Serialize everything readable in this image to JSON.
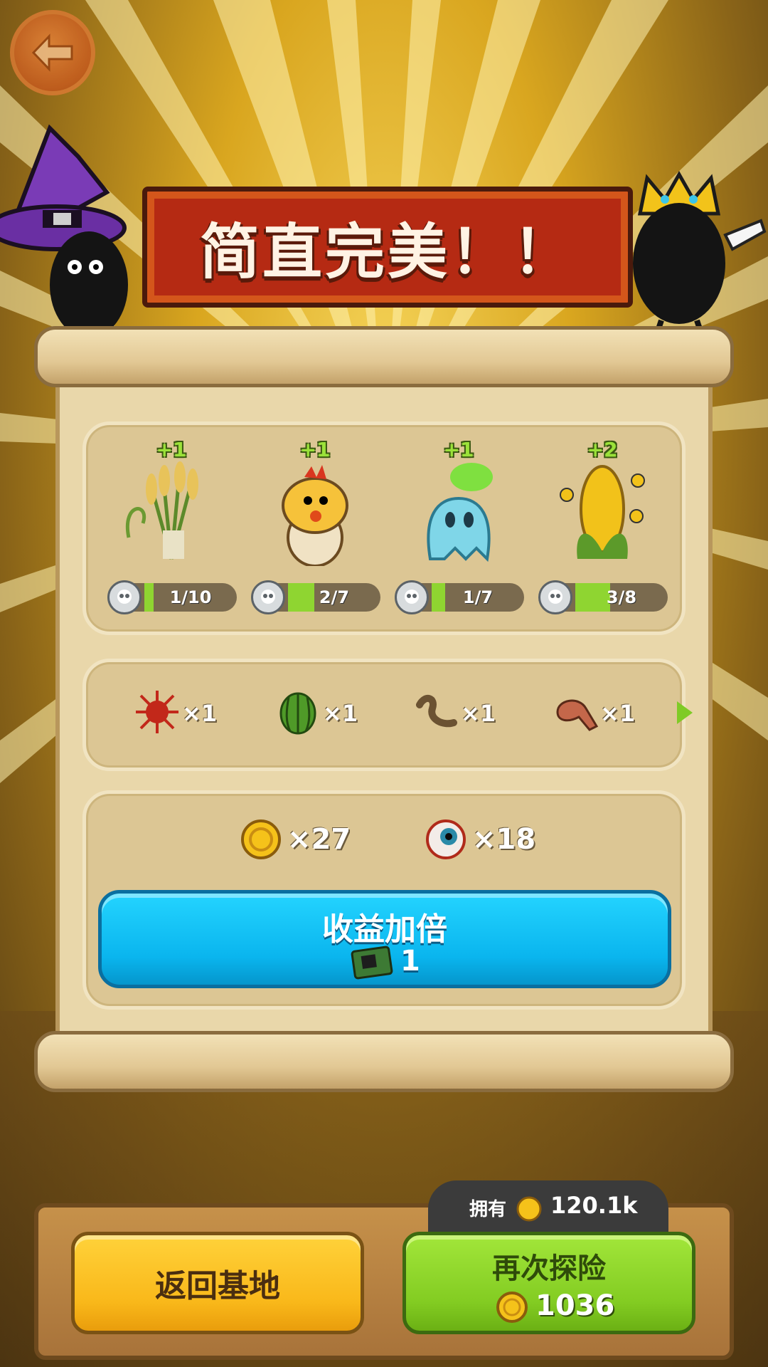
{
  "banner": {
    "title": "简直完美！！"
  },
  "creatures": [
    {
      "name": "rice",
      "plus": "+1",
      "progress_text": "1/10",
      "progress": 0.1
    },
    {
      "name": "chick",
      "plus": "+1",
      "progress_text": "2/7",
      "progress": 0.2857
    },
    {
      "name": "ghost-radish",
      "plus": "+1",
      "progress_text": "1/7",
      "progress": 0.1429
    },
    {
      "name": "corn",
      "plus": "+2",
      "progress_text": "3/8",
      "progress": 0.375
    }
  ],
  "items": [
    {
      "icon": "red-urchin-icon",
      "count": "×1"
    },
    {
      "icon": "watermelon-icon",
      "count": "×1"
    },
    {
      "icon": "worm-icon",
      "count": "×1"
    },
    {
      "icon": "drumstick-icon",
      "count": "×1"
    }
  ],
  "rewards": [
    {
      "icon": "gold-coin-icon",
      "count": "×27"
    },
    {
      "icon": "eyeball-icon",
      "count": "×18"
    }
  ],
  "double_button": {
    "label": "收益加倍",
    "cost": "1"
  },
  "owned": {
    "label": "拥有",
    "value": "120.1k"
  },
  "buttons": {
    "return_label": "返回基地",
    "again_label": "再次探险",
    "again_cost": "1036"
  },
  "colors": {
    "banner_red": "#b52a13",
    "blue_button": "#0ab5ee",
    "green_button": "#83cc22",
    "yellow_button": "#f9b81a",
    "progress_green": "#8fd531"
  }
}
